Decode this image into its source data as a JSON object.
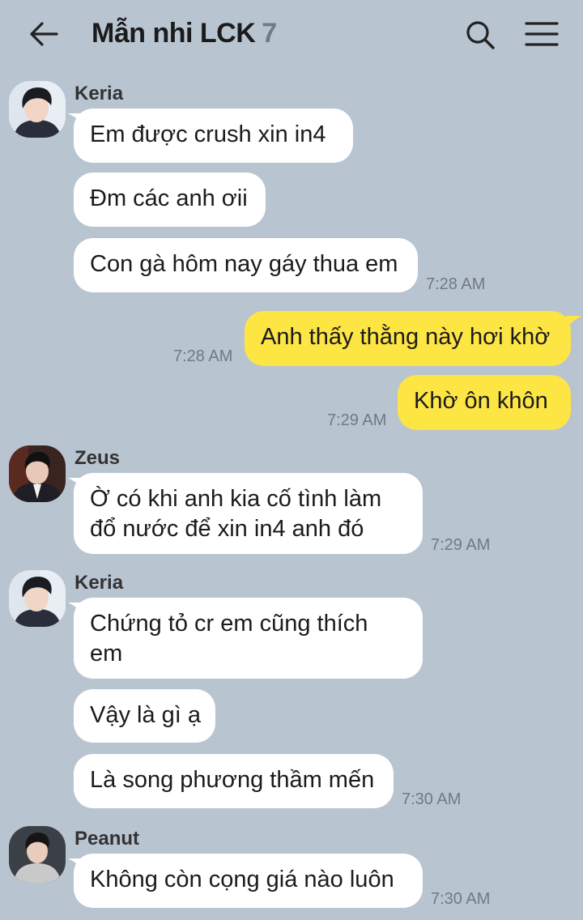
{
  "header": {
    "title": "Mẫn nhi LCK",
    "member_count": "7",
    "back_icon": "arrow-left-icon",
    "search_icon": "search-icon",
    "menu_icon": "hamburger-menu-icon"
  },
  "colors": {
    "background": "#b9c4d1",
    "incoming_bubble": "#ffffff",
    "outgoing_bubble": "#fde544"
  },
  "messages": {
    "group1": {
      "sender": "Keria",
      "m1": "Em được crush xin in4",
      "m2": "Đm các anh ơii",
      "m3": "Con gà hôm nay gáy thua em",
      "time": "7:28 AM"
    },
    "mine1": {
      "text": "Anh thấy thằng này hơi khờ",
      "time": "7:28 AM"
    },
    "mine2": {
      "text": "Khờ ôn khôn",
      "time": "7:29 AM"
    },
    "group2": {
      "sender": "Zeus",
      "m1_line1": "Ờ có khi anh kia cố tình làm",
      "m1_line2": "đổ nước để xin in4 anh đó",
      "time": "7:29 AM"
    },
    "group3": {
      "sender": "Keria",
      "m1_line1": "Chứng tỏ cr em cũng thích",
      "m1_line2": "em",
      "m2": "Vậy là gì ạ",
      "m3": "Là song phương thầm mến",
      "time": "7:30 AM"
    },
    "group4": {
      "sender": "Peanut",
      "m1": "Không còn cọng giá nào luôn",
      "time": "7:30 AM"
    }
  }
}
